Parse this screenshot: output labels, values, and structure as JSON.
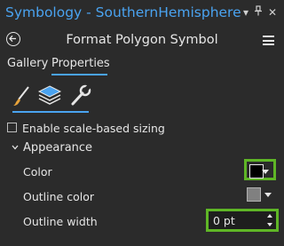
{
  "window": {
    "title": "Symbology - SouthernHemisphere",
    "title_color": "#4aa3f0"
  },
  "header": {
    "title": "Format Polygon Symbol"
  },
  "tabs": [
    {
      "label": "Gallery",
      "active": false
    },
    {
      "label": "Properties",
      "active": true
    }
  ],
  "icon_tabs": [
    {
      "name": "paintbrush-icon",
      "active": true
    },
    {
      "name": "layers-icon",
      "active": true
    },
    {
      "name": "wrench-icon",
      "active": false
    }
  ],
  "scale_sizing": {
    "label": "Enable scale-based sizing",
    "checked": false
  },
  "appearance": {
    "label": "Appearance",
    "color": {
      "label": "Color",
      "value": "#000000"
    },
    "outline_color": {
      "label": "Outline color",
      "value": "#808080"
    },
    "outline_width": {
      "label": "Outline width",
      "value": "0 pt"
    }
  },
  "highlight_color": "#5fb626"
}
